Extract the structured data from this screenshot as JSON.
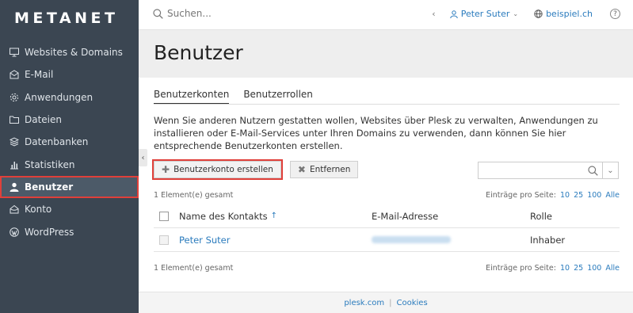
{
  "brand": {
    "logo": "METANET"
  },
  "sidebar": {
    "items": [
      {
        "label": "Websites & Domains",
        "icon": "monitor-icon"
      },
      {
        "label": "E-Mail",
        "icon": "envelope-icon"
      },
      {
        "label": "Anwendungen",
        "icon": "gear-icon"
      },
      {
        "label": "Dateien",
        "icon": "folder-icon"
      },
      {
        "label": "Datenbanken",
        "icon": "database-icon"
      },
      {
        "label": "Statistiken",
        "icon": "bar-chart-icon"
      },
      {
        "label": "Benutzer",
        "icon": "user-icon",
        "active": true
      },
      {
        "label": "Konto",
        "icon": "house-icon"
      },
      {
        "label": "WordPress",
        "icon": "wordpress-icon"
      }
    ]
  },
  "topbar": {
    "search_placeholder": "Suchen...",
    "back_label": "‹",
    "user_name": "Peter Suter",
    "domain": "beispiel.ch",
    "help_label": "?"
  },
  "page": {
    "title": "Benutzer"
  },
  "tabs": [
    {
      "label": "Benutzerkonten",
      "active": true
    },
    {
      "label": "Benutzerrollen",
      "active": false
    }
  ],
  "description": "Wenn Sie anderen Nutzern gestatten wollen, Websites über Plesk zu verwalten, Anwendungen zu installieren oder E-Mail-Services unter Ihren Domains zu verwenden, dann können Sie hier entsprechende Benutzerkonten erstellen.",
  "toolbar": {
    "create_label": "Benutzerkonto erstellen",
    "remove_label": "Entfernen"
  },
  "list": {
    "count_label": "1 Element(e) gesamt",
    "perpage_label": "Einträge pro Seite:",
    "perpage_options": [
      "10",
      "25",
      "100",
      "Alle"
    ],
    "columns": {
      "name": "Name des Kontakts",
      "email": "E-Mail-Adresse",
      "role": "Rolle"
    },
    "rows": [
      {
        "name": "Peter Suter",
        "email": "",
        "role": "Inhaber"
      }
    ]
  },
  "footer": {
    "link1": "plesk.com",
    "link2": "Cookies"
  },
  "colors": {
    "sidebar_bg": "#3b4652",
    "accent": "#2a7bbd",
    "highlight": "#e0403a"
  }
}
